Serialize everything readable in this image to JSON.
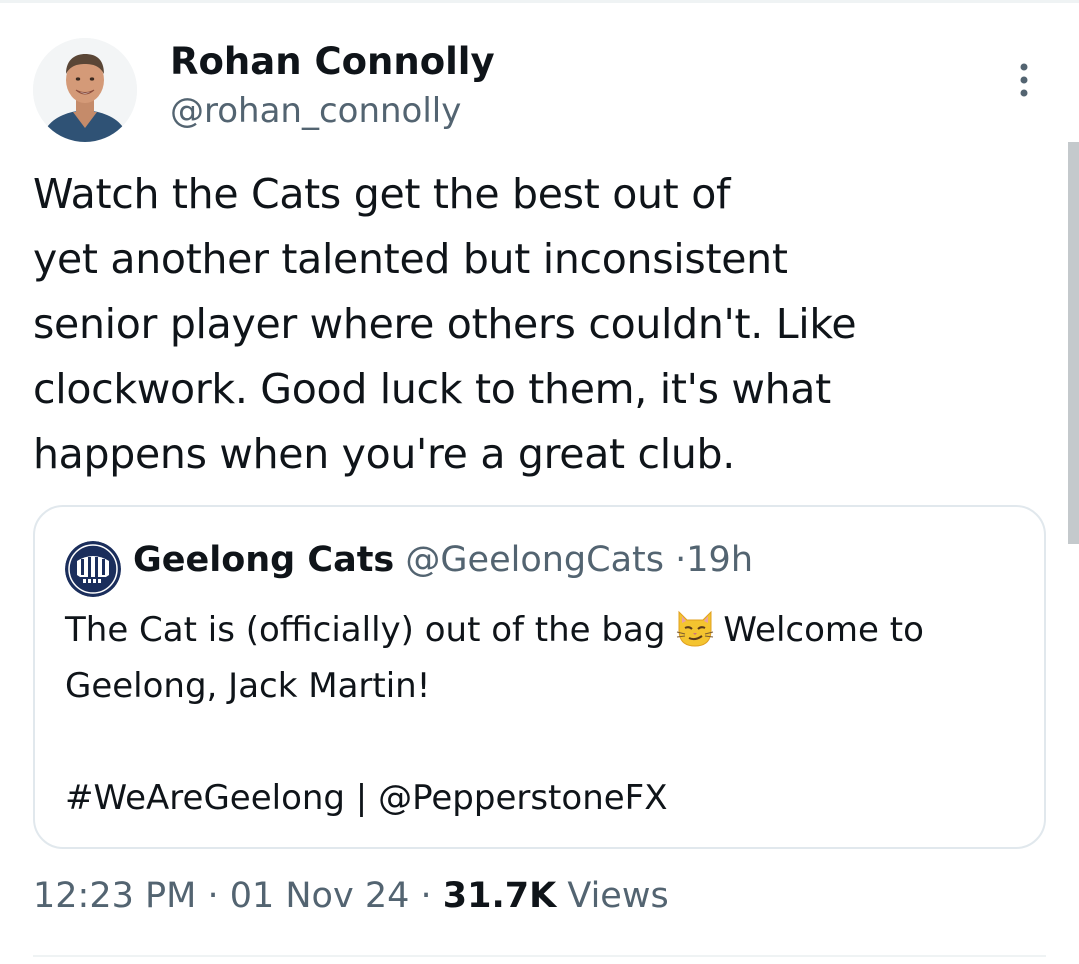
{
  "tweet": {
    "author_name": "Rohan Connolly",
    "author_handle": "@rohan_connolly",
    "text": "Watch the Cats get the best out of\nyet another talented but inconsistent\nsenior player where others couldn't. Like\nclockwork. Good luck to them, it's what\nhappens when you're a great club.",
    "more_icon": "more-vertical-icon"
  },
  "quote": {
    "author_name": "Geelong Cats",
    "author_handle": "@GeelongCats",
    "separator": "·",
    "time_ago": "19h",
    "text_before_emoji": "The Cat is (officially) out of the bag",
    "emoji_icon": "smirking-cat-icon",
    "text_after_emoji": "Welcome to Geelong, Jack Martin!",
    "hashtags_line": "#WeAreGeelong | @PepperstoneFX",
    "avatar_icon": "geelong-cats-logo-icon"
  },
  "footer": {
    "time": "12:23 PM",
    "separator": "·",
    "date": "01 Nov 24",
    "views_count": "31.7K",
    "views_label": "Views"
  },
  "colors": {
    "text_primary": "#0f1419",
    "text_secondary": "#536471",
    "border": "#e1e8ed",
    "divider": "#eff3f4",
    "club_navy": "#1b2e5c"
  }
}
